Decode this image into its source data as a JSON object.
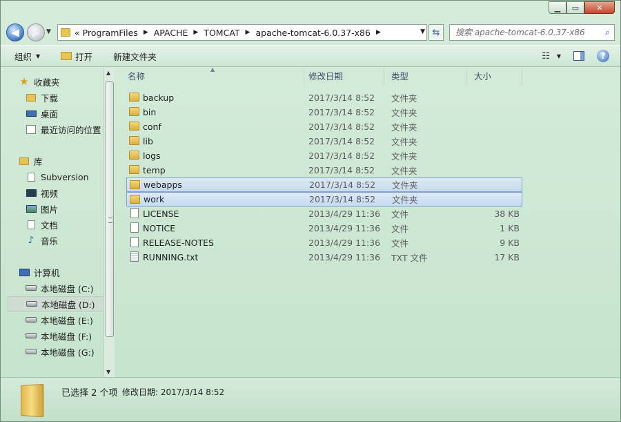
{
  "window": {
    "address": {
      "prefix": "«",
      "crumbs": [
        "ProgramFiles",
        "APACHE",
        "TOMCAT",
        "apache-tomcat-6.0.37-x86"
      ]
    },
    "search_placeholder": "搜索 apache-tomcat-6.0.37-x86"
  },
  "toolbar": {
    "organize": "组织",
    "open": "打开",
    "new_folder": "新建文件夹"
  },
  "nav": {
    "favorites": {
      "label": "收藏夹",
      "items": [
        "下载",
        "桌面",
        "最近访问的位置"
      ]
    },
    "libraries": {
      "label": "库",
      "items": [
        "Subversion",
        "视频",
        "图片",
        "文档",
        "音乐"
      ]
    },
    "computer": {
      "label": "计算机",
      "items": [
        "本地磁盘 (C:)",
        "本地磁盘 (D:)",
        "本地磁盘 (E:)",
        "本地磁盘 (F:)",
        "本地磁盘 (G:)"
      ],
      "selected_index": 1
    }
  },
  "columns": {
    "name": "名称",
    "date": "修改日期",
    "type": "类型",
    "size": "大小"
  },
  "files": [
    {
      "name": "backup",
      "date": "2017/3/14 8:52",
      "type": "文件夹",
      "size": "",
      "icon": "folder-icon",
      "selected": false
    },
    {
      "name": "bin",
      "date": "2017/3/14 8:52",
      "type": "文件夹",
      "size": "",
      "icon": "folder-icon",
      "selected": false
    },
    {
      "name": "conf",
      "date": "2017/3/14 8:52",
      "type": "文件夹",
      "size": "",
      "icon": "folder-icon",
      "selected": false
    },
    {
      "name": "lib",
      "date": "2017/3/14 8:52",
      "type": "文件夹",
      "size": "",
      "icon": "folder-icon",
      "selected": false
    },
    {
      "name": "logs",
      "date": "2017/3/14 8:52",
      "type": "文件夹",
      "size": "",
      "icon": "folder-icon",
      "selected": false
    },
    {
      "name": "temp",
      "date": "2017/3/14 8:52",
      "type": "文件夹",
      "size": "",
      "icon": "folder-icon",
      "selected": false
    },
    {
      "name": "webapps",
      "date": "2017/3/14 8:52",
      "type": "文件夹",
      "size": "",
      "icon": "folder-icon",
      "selected": true
    },
    {
      "name": "work",
      "date": "2017/3/14 8:52",
      "type": "文件夹",
      "size": "",
      "icon": "folder-icon",
      "selected": true
    },
    {
      "name": "LICENSE",
      "date": "2013/4/29 11:36",
      "type": "文件",
      "size": "38 KB",
      "icon": "file-icon",
      "selected": false
    },
    {
      "name": "NOTICE",
      "date": "2013/4/29 11:36",
      "type": "文件",
      "size": "1 KB",
      "icon": "file-icon",
      "selected": false
    },
    {
      "name": "RELEASE-NOTES",
      "date": "2013/4/29 11:36",
      "type": "文件",
      "size": "9 KB",
      "icon": "file-icon",
      "selected": false
    },
    {
      "name": "RUNNING.txt",
      "date": "2013/4/29 11:36",
      "type": "TXT 文件",
      "size": "17 KB",
      "icon": "text-file-icon",
      "selected": false
    }
  ],
  "details": {
    "count_text": "已选择 2 个项",
    "date_label": "修改日期:",
    "date_value": "2017/3/14 8:52"
  }
}
